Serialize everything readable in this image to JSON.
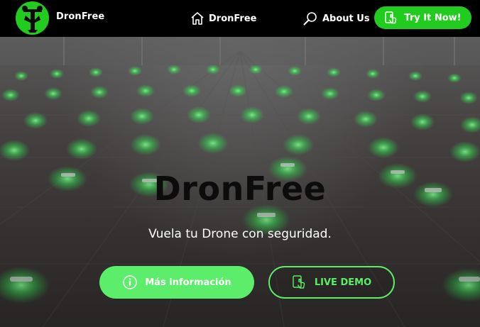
{
  "navbar": {
    "brand": "DronFree",
    "home_label": "DronFree",
    "about_label": "About Us",
    "cta_label": "Try It Now!"
  },
  "hero": {
    "title": "DronFree",
    "subtitle": "Vuela tu Drone con seguridad.",
    "info_button": "Más información",
    "demo_button": "LIVE DEMO"
  },
  "colors": {
    "accent": "#22cc1f",
    "accent_light": "#5ced6a",
    "navbar_bg": "#000000"
  },
  "icons": [
    "drone-logo-icon",
    "home-icon",
    "search-icon",
    "phone-tap-icon",
    "info-icon"
  ]
}
